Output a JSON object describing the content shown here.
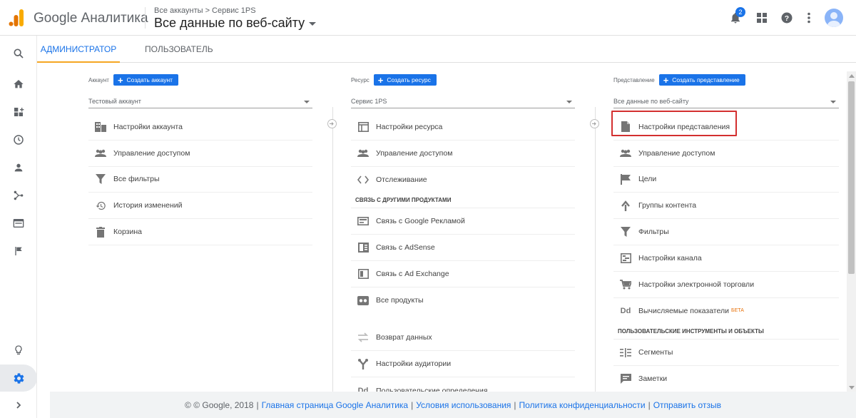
{
  "header": {
    "brand": "Google Аналитика",
    "breadcrumb": "Все аккаунты > Сервис 1PS",
    "view_title": "Все данные по веб-сайту",
    "notifications_count": "2"
  },
  "tabs": [
    {
      "label": "АДМИНИСТРАТОР"
    },
    {
      "label": "ПОЛЬЗОВАТЕЛЬ"
    }
  ],
  "account": {
    "label": "Аккаунт",
    "create_label": "Создать аккаунт",
    "selected": "Тестовый аккаунт",
    "items": [
      {
        "label": "Настройки аккаунта"
      },
      {
        "label": "Управление доступом"
      },
      {
        "label": "Все фильтры"
      },
      {
        "label": "История изменений"
      },
      {
        "label": "Корзина"
      }
    ]
  },
  "property": {
    "label": "Ресурс",
    "create_label": "Создать ресурс",
    "selected": "Сервис 1PS",
    "items": [
      {
        "label": "Настройки ресурса"
      },
      {
        "label": "Управление доступом"
      },
      {
        "label": "Отслеживание"
      }
    ],
    "section_title": "СВЯЗЬ С ДРУГИМИ ПРОДУКТАМИ",
    "linked_items": [
      {
        "label": "Связь с Google Рекламой"
      },
      {
        "label": "Связь с AdSense"
      },
      {
        "label": "Связь с Ad Exchange"
      },
      {
        "label": "Все продукты"
      }
    ],
    "more_items": [
      {
        "label": "Возврат данных"
      },
      {
        "label": "Настройки аудитории"
      },
      {
        "label": "Пользовательские определения"
      }
    ]
  },
  "view": {
    "label": "Представление",
    "create_label": "Создать представление",
    "selected": "Все данные по веб-сайту",
    "items": [
      {
        "label": "Настройки представления"
      },
      {
        "label": "Управление доступом"
      },
      {
        "label": "Цели"
      },
      {
        "label": "Группы контента"
      },
      {
        "label": "Фильтры"
      },
      {
        "label": "Настройки канала"
      },
      {
        "label": "Настройки электронной торговли"
      },
      {
        "label": "Вычисляемые показатели"
      }
    ],
    "beta_label": "БЕТА",
    "section_title": "ПОЛЬЗОВАТЕЛЬСКИЕ ИНСТРУМЕНТЫ И ОБЪЕКТЫ",
    "tool_items": [
      {
        "label": "Сегменты"
      },
      {
        "label": "Заметки"
      }
    ]
  },
  "footer": {
    "copyright": "© © Google, 2018",
    "links": [
      "Главная страница Google Аналитика",
      "Условия использования",
      "Политика конфиденциальности",
      "Отправить отзыв"
    ]
  },
  "colors": {
    "accent": "#1a73e8",
    "tab_underline": "#f5a623",
    "highlight": "#d32f2f"
  }
}
